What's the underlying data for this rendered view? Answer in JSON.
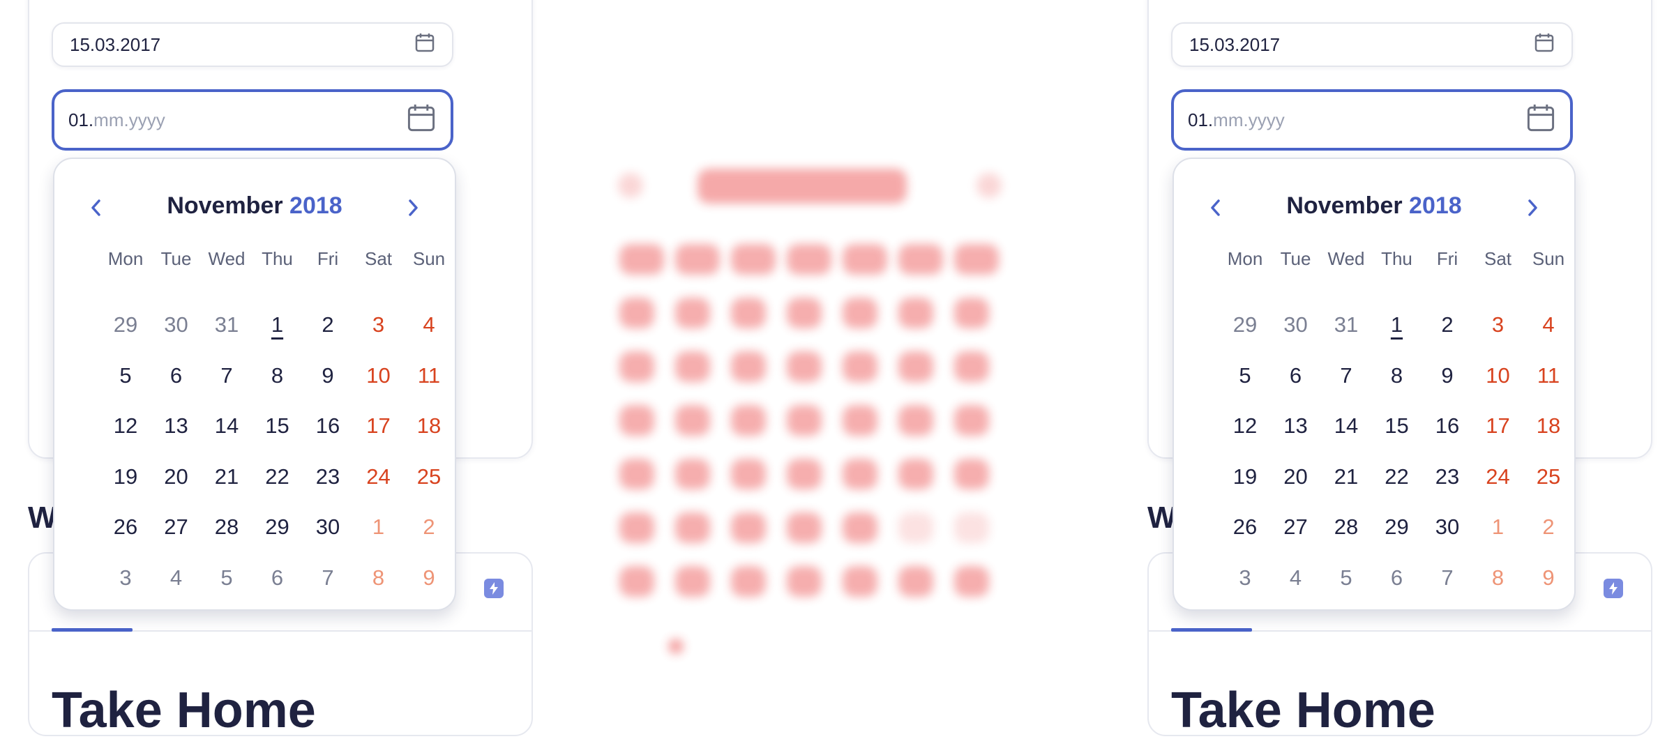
{
  "colors": {
    "accent": "#4a63c9",
    "weekend": "#d8431f",
    "weekend_muted": "#ee9476",
    "text": "#1f2240"
  },
  "panels": [
    {
      "filled_input": {
        "value": "15.03.2017",
        "icon": "calendar-icon"
      },
      "active_input": {
        "typed": "01.",
        "placeholder": "mm.yyyy",
        "icon": "calendar-icon"
      },
      "section_heading": "W",
      "big_heading": "Take Home",
      "calendar": {
        "month": "November",
        "year": "2018",
        "weekdays": [
          "Mon",
          "Tue",
          "Wed",
          "Thu",
          "Fri",
          "Sat",
          "Sun"
        ],
        "weeks": [
          [
            "29",
            "30",
            "31",
            "1",
            "2",
            "3",
            "4"
          ],
          [
            "5",
            "6",
            "7",
            "8",
            "9",
            "10",
            "11"
          ],
          [
            "12",
            "13",
            "14",
            "15",
            "16",
            "17",
            "18"
          ],
          [
            "19",
            "20",
            "21",
            "22",
            "23",
            "24",
            "25"
          ],
          [
            "26",
            "27",
            "28",
            "29",
            "30",
            "1",
            "2"
          ],
          [
            "3",
            "4",
            "5",
            "6",
            "7",
            "8",
            "9"
          ]
        ],
        "today": "1"
      }
    },
    {
      "filled_input": {
        "value": "15.03.2017",
        "icon": "calendar-icon"
      },
      "active_input": {
        "typed": "01.",
        "placeholder": "mm.yyyy",
        "icon": "calendar-icon"
      },
      "section_heading": "W",
      "big_heading": "Take Home",
      "calendar": {
        "month": "November",
        "year": "2018",
        "weekdays": [
          "Mon",
          "Tue",
          "Wed",
          "Thu",
          "Fri",
          "Sat",
          "Sun"
        ],
        "weeks": [
          [
            "29",
            "30",
            "31",
            "1",
            "2",
            "3",
            "4"
          ],
          [
            "5",
            "6",
            "7",
            "8",
            "9",
            "10",
            "11"
          ],
          [
            "12",
            "13",
            "14",
            "15",
            "16",
            "17",
            "18"
          ],
          [
            "19",
            "20",
            "21",
            "22",
            "23",
            "24",
            "25"
          ],
          [
            "26",
            "27",
            "28",
            "29",
            "30",
            "1",
            "2"
          ],
          [
            "3",
            "4",
            "5",
            "6",
            "7",
            "8",
            "9"
          ]
        ],
        "today": "1"
      }
    }
  ]
}
